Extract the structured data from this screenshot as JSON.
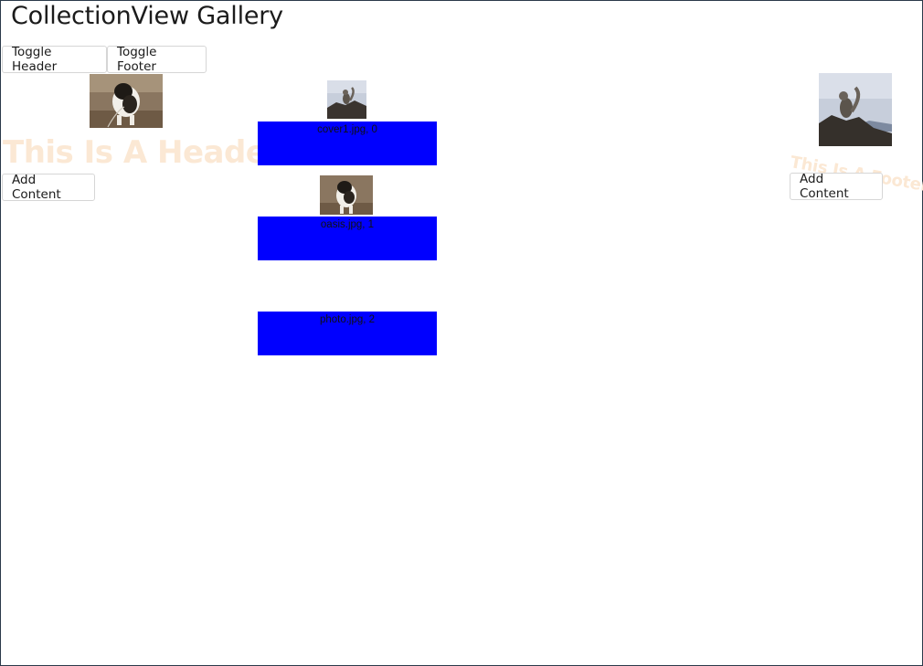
{
  "page": {
    "title": "CollectionView Gallery"
  },
  "toolbar": {
    "toggle_header_label": "Toggle Header",
    "toggle_footer_label": "Toggle Footer"
  },
  "header": {
    "text": "This Is A Header",
    "add_content_label": "Add Content",
    "image_icon": "dog-photo"
  },
  "footer": {
    "text": "This Is A Footer",
    "add_content_label": "Add Content",
    "image_icon": "squirrel-photo"
  },
  "items": [
    {
      "caption": "cover1.jpg, 0",
      "image_icon": "squirrel-photo"
    },
    {
      "caption": "oasis.jpg, 1",
      "image_icon": "dog-photo"
    },
    {
      "caption": "photo.jpg, 2",
      "image_icon": ""
    }
  ],
  "colors": {
    "caption_background": "#0000ff",
    "header_footer_text": "#fbe8d4",
    "window_border": "#2b3a4a"
  }
}
